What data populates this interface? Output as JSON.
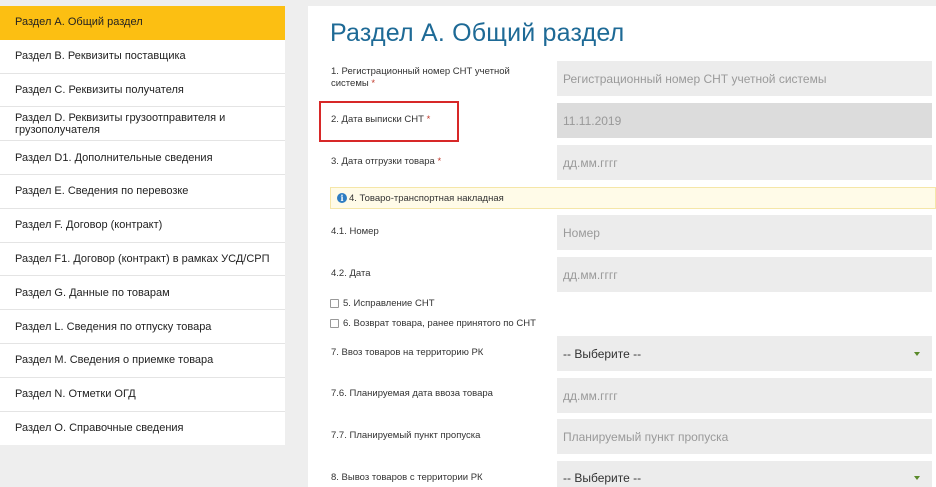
{
  "sidebar": {
    "items": [
      {
        "label": "Раздел A. Общий раздел",
        "active": true
      },
      {
        "label": "Раздел B. Реквизиты поставщика"
      },
      {
        "label": "Раздел C. Реквизиты получателя"
      },
      {
        "label": "Раздел D. Реквизиты грузоотправителя и грузополучателя"
      },
      {
        "label": "Раздел D1. Дополнительные сведения"
      },
      {
        "label": "Раздел E. Сведения по перевозке"
      },
      {
        "label": "Раздел F. Договор (контракт)"
      },
      {
        "label": "Раздел F1. Договор (контракт) в рамках УСД/СРП"
      },
      {
        "label": "Раздел G. Данные по товарам"
      },
      {
        "label": "Раздел L. Сведения по отпуску товара"
      },
      {
        "label": "Раздел M. Сведения о приемке товара"
      },
      {
        "label": "Раздел N. Отметки ОГД"
      },
      {
        "label": "Раздел O. Справочные сведения"
      }
    ]
  },
  "main": {
    "title": "Раздел А. Общий раздел",
    "required_mark": "*",
    "fields": {
      "reg_number": {
        "label": "1. Регистрационный номер СНТ учетной системы",
        "placeholder": "Регистрационный номер СНТ учетной системы"
      },
      "issue_date": {
        "label": "2. Дата выписки СНТ",
        "value": "11.11.2019"
      },
      "ship_date": {
        "label": "3. Дата отгрузки товара",
        "placeholder": "дд.мм.гггг"
      },
      "waybill_info": "4. Товаро-транспортная накладная",
      "number": {
        "label": "4.1. Номер",
        "placeholder": "Номер"
      },
      "date": {
        "label": "4.2. Дата",
        "placeholder": "дд.мм.гггг"
      },
      "correction": "5. Исправление СНТ",
      "return": "6. Возврат товара, ранее принятого по СНТ",
      "import": {
        "label": "7. Ввоз товаров на территорию РК",
        "value": "-- Выберите --"
      },
      "import_date": {
        "label": "7.6. Планируемая дата ввоза товара",
        "placeholder": "дд.мм.гггг"
      },
      "checkpoint": {
        "label": "7.7. Планируемый пункт пропуска",
        "placeholder": "Планируемый пункт пропуска"
      },
      "export": {
        "label": "8. Вывоз товаров с территории РК",
        "value": "-- Выберите --"
      }
    }
  },
  "colors": {
    "active_item": "#fcbf12",
    "title": "#1e6a96",
    "highlight_border": "#d72828",
    "info_icon": "#2e7dc2"
  }
}
